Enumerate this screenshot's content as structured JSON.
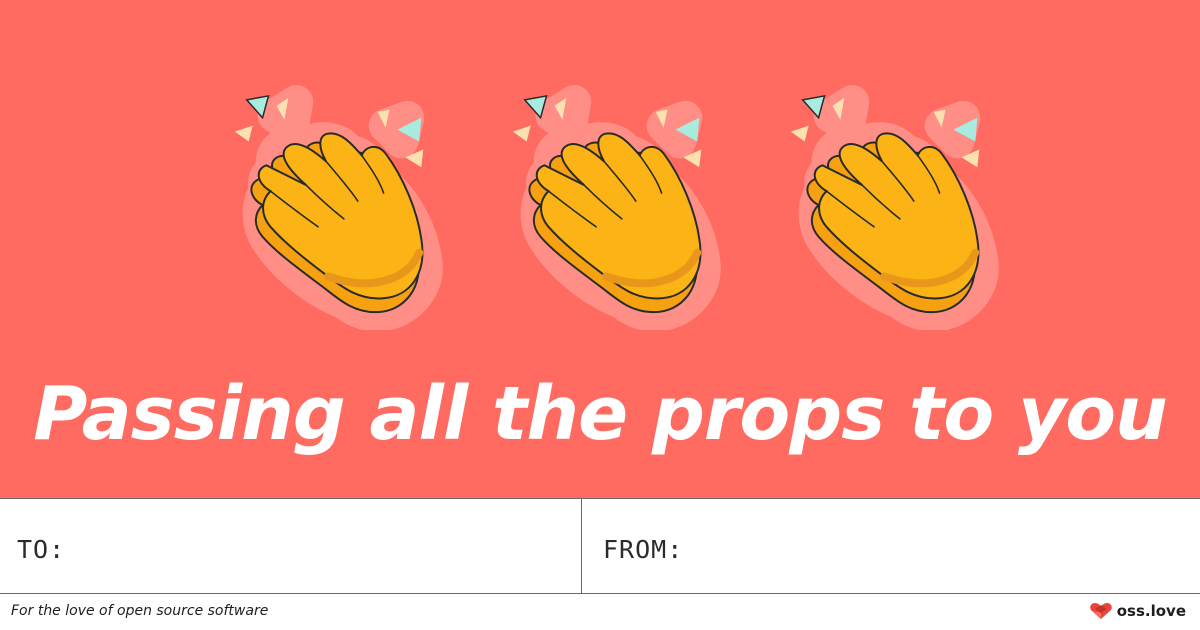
{
  "card": {
    "headline": "Passing all the props to you",
    "emoji": [
      "clapping-hands-icon",
      "clapping-hands-icon",
      "clapping-hands-icon"
    ],
    "colors": {
      "background": "#ff6b61",
      "emoji_halo": "#ff9187",
      "hand_fill": "#fcb316",
      "hand_shadow": "#e9971b",
      "spark_teal": "#a8ece0",
      "spark_cream": "#fbe0b0"
    }
  },
  "fields": {
    "to_label": "TO:",
    "from_label": "FROM:"
  },
  "footer": {
    "tagline": "For the love of open source software",
    "brand": "oss.love",
    "brand_icon": "heart-logo-icon",
    "brand_color": "#e8453c"
  }
}
